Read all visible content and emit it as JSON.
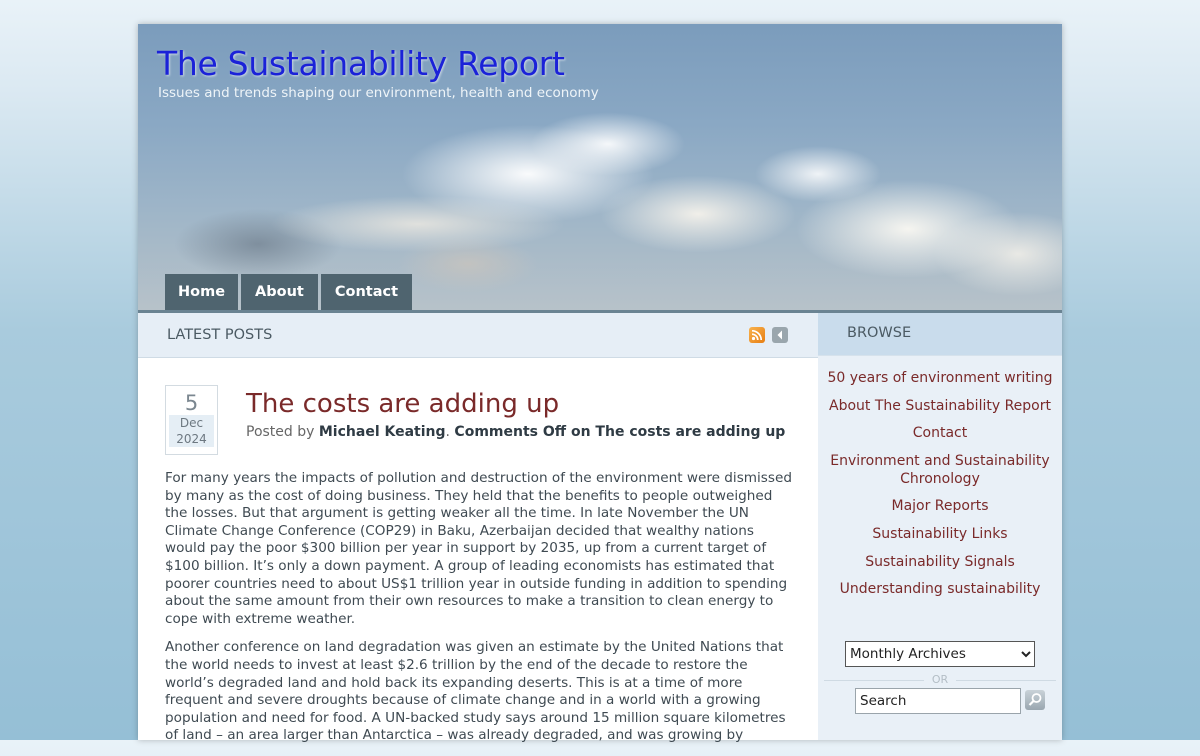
{
  "site": {
    "title": "The Sustainability Report",
    "tagline": "Issues and trends shaping our environment, health and economy"
  },
  "nav": {
    "items": [
      {
        "label": "Home"
      },
      {
        "label": "About"
      },
      {
        "label": "Contact"
      }
    ]
  },
  "latest": {
    "heading": "LATEST POSTS"
  },
  "post": {
    "date": {
      "day": "5",
      "month": "Dec",
      "year": "2024"
    },
    "title": "The costs are adding up",
    "meta_posted_by": "Posted by",
    "author": "Michael Keating",
    "comments": "Comments Off on The costs are adding up",
    "paragraphs": [
      "For many years the impacts of pollution and destruction of the environment were dismissed by many as the cost of doing business. They held that the benefits to people outweighed the losses. But that argument is getting weaker all the time. In late November the UN Climate Change Conference (COP29) in Baku, Azerbaijan decided that wealthy nations would pay the poor $300 billion per year in support by 2035, up from a current target of $100 billion. It’s only a down payment. A group of leading economists has estimated that poorer countries need to about US$1 trillion year in outside funding in addition to spending about the same amount from their own resources to make a transition to clean energy to cope with extreme weather.",
      "Another conference on land degradation was given an estimate by the United Nations that the world needs to invest at least $2.6 trillion by the end of the decade to restore the world’s degraded land and hold back its expanding deserts. This is at a time of more frequent and severe droughts because of climate change and in a world with a growing population and need for food. A UN-backed study says around 15 million square kilometres of land – an area larger than Antarctica – was already degraded, and was growing by"
    ]
  },
  "sidebar": {
    "heading": "BROWSE",
    "links": [
      {
        "label": "50 years of environment writing"
      },
      {
        "label": "About The Sustainability Report"
      },
      {
        "label": "Contact"
      },
      {
        "label": "Environment and Sustainability Chronology"
      },
      {
        "label": "Major Reports"
      },
      {
        "label": "Sustainability Links"
      },
      {
        "label": "Sustainability Signals"
      },
      {
        "label": "Understanding sustainability"
      }
    ],
    "archives_selected": "Monthly Archives",
    "or_label": "OR",
    "search_value": "Search"
  },
  "icons": {
    "rss": "rss-icon",
    "back": "chevron-left-icon",
    "search_go": "search-icon"
  }
}
